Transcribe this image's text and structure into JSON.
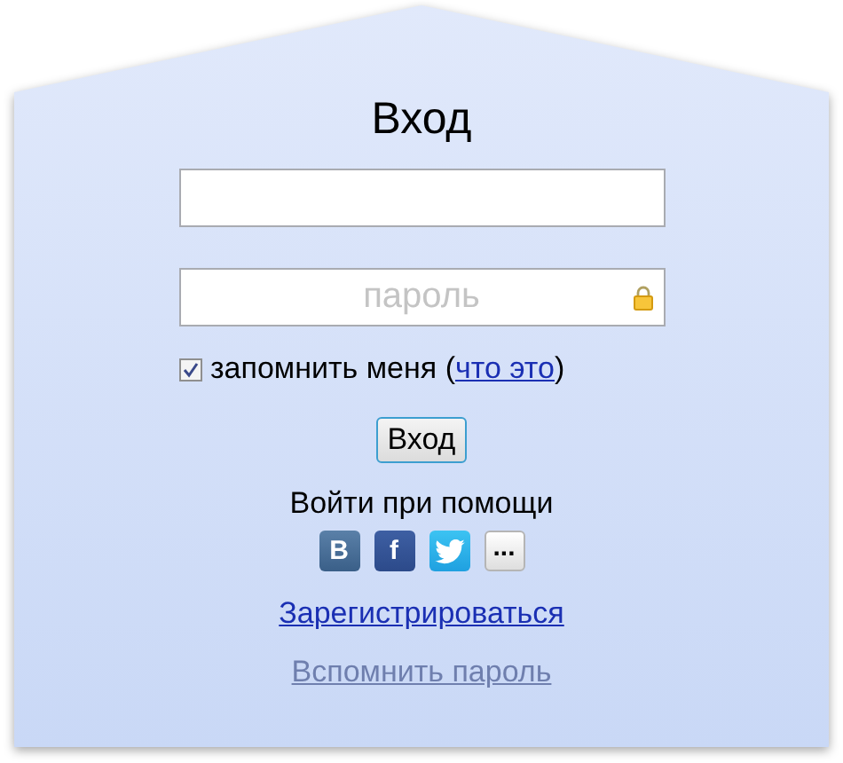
{
  "title": "Вход",
  "password": {
    "placeholder": "пароль"
  },
  "remember": {
    "label": "запомнить меня",
    "checked": true,
    "open_paren": "(",
    "link": "что это",
    "close_paren": ")"
  },
  "submit": "Вход",
  "social": {
    "label": "Войти при помощи",
    "items": [
      {
        "kind": "vk",
        "glyph": "B"
      },
      {
        "kind": "facebook",
        "glyph": "f"
      },
      {
        "kind": "twitter"
      },
      {
        "kind": "more",
        "glyph": "..."
      }
    ]
  },
  "register": "Зарегистрироваться",
  "forgot": "Вспомнить пароль"
}
